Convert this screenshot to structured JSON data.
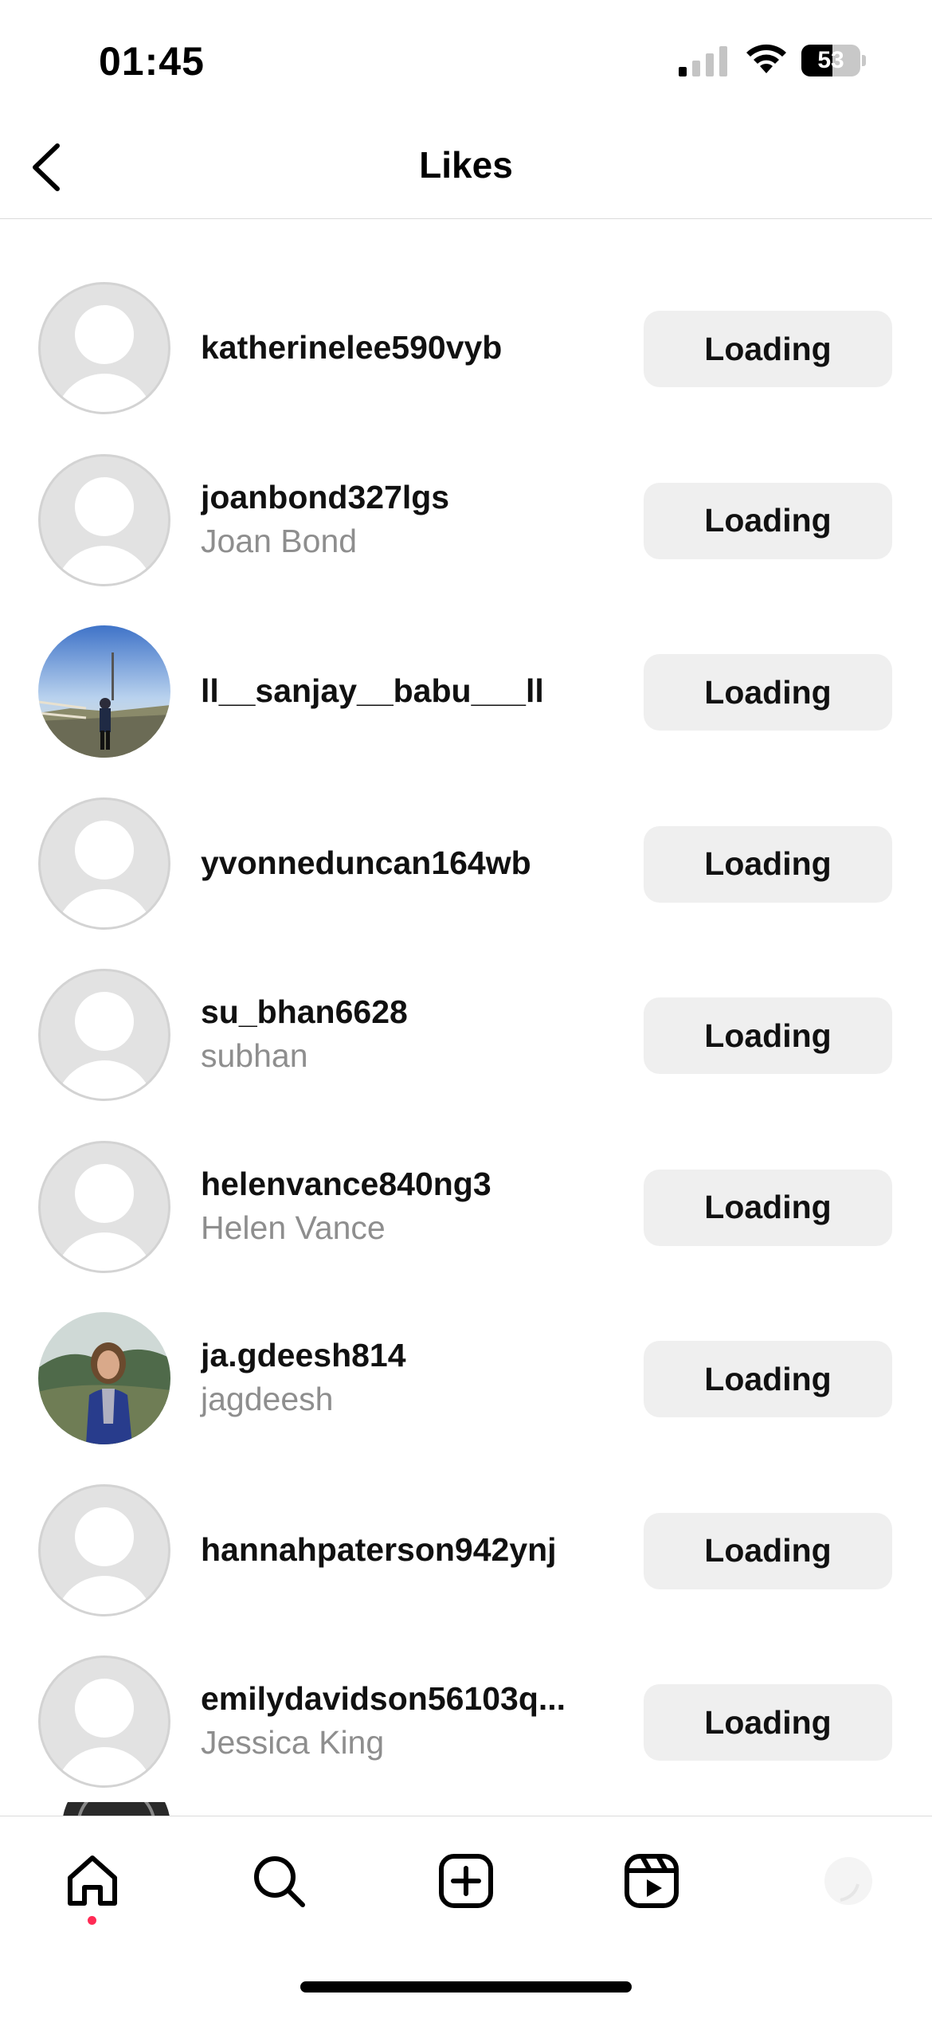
{
  "status_bar": {
    "time": "01:45",
    "battery_level": "53",
    "battery_fraction": 0.53
  },
  "header": {
    "title": "Likes",
    "back_icon": "chevron-left-icon"
  },
  "likes": [
    {
      "username": "katherinelee590vyb",
      "full_name": "",
      "button_label": "Loading",
      "avatar": "placeholder"
    },
    {
      "username": "joanbond327lgs",
      "full_name": "Joan Bond",
      "button_label": "Loading",
      "avatar": "placeholder"
    },
    {
      "username": "ll__sanjay__babu___ll",
      "full_name": "",
      "button_label": "Loading",
      "avatar": "photo-outdoor-man"
    },
    {
      "username": "yvonneduncan164wb",
      "full_name": "",
      "button_label": "Loading",
      "avatar": "placeholder"
    },
    {
      "username": "su_bhan6628",
      "full_name": "subhan",
      "button_label": "Loading",
      "avatar": "placeholder"
    },
    {
      "username": "helenvance840ng3",
      "full_name": "Helen Vance",
      "button_label": "Loading",
      "avatar": "placeholder"
    },
    {
      "username": "ja.gdeesh814",
      "full_name": "jagdeesh",
      "button_label": "Loading",
      "avatar": "photo-woman-hills"
    },
    {
      "username": "hannahpaterson942ynj",
      "full_name": "",
      "button_label": "Loading",
      "avatar": "placeholder"
    },
    {
      "username": "emilydavidson56103q...",
      "full_name": "Jessica King",
      "button_label": "Loading",
      "avatar": "placeholder"
    }
  ],
  "bottom_nav": {
    "items": [
      "home-icon",
      "search-icon",
      "create-icon",
      "reels-icon",
      "profile-icon"
    ],
    "active": "home-icon"
  },
  "colors": {
    "button_bg": "#efefef",
    "secondary_text": "#8e8e8e",
    "notification_dot": "#ff2b55"
  }
}
